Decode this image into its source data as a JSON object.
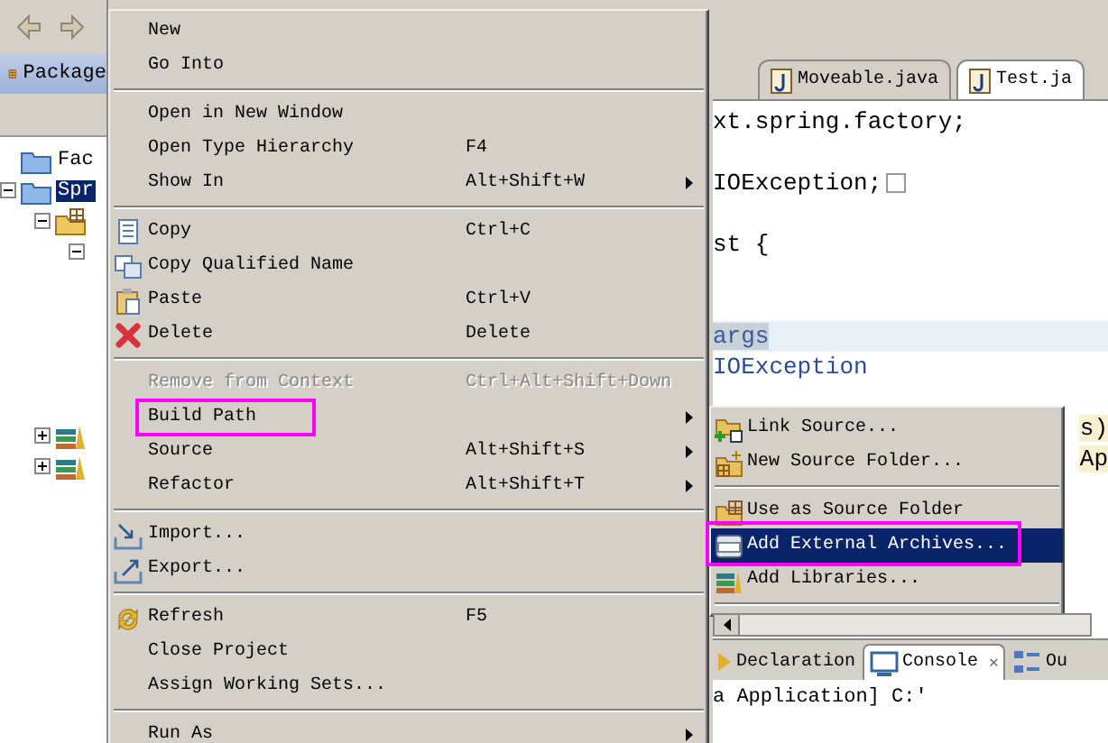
{
  "package_explorer": {
    "tab": "Package",
    "tree": [
      {
        "label": "Fac",
        "kind": "project",
        "selected": false
      },
      {
        "label": "Spr",
        "kind": "project",
        "selected": true,
        "expanded": true,
        "children": [
          {
            "kind": "folder",
            "expanded": true,
            "children": [
              {
                "expanded": true
              }
            ]
          },
          {
            "kind": "library",
            "expanded": false
          },
          {
            "kind": "library",
            "expanded": false
          }
        ]
      }
    ]
  },
  "editor": {
    "tabs": [
      {
        "label": "Moveable.java",
        "selected": false
      },
      {
        "label": "Test.ja",
        "selected": true
      }
    ],
    "lines": [
      {
        "text": "xt.spring.factory;",
        "kind": "plain"
      },
      {
        "kind": "blank"
      },
      {
        "text": "IOException;",
        "kind": "folded"
      },
      {
        "kind": "blank"
      },
      {
        "text": "st {",
        "kind": "plain"
      },
      {
        "kind": "blank"
      },
      {
        "kind": "blank"
      },
      {
        "text": "args",
        "kind": "current"
      },
      {
        "text": "IOException",
        "kind": "keyword"
      },
      {
        "kind": "blank"
      },
      {
        "text": "s)",
        "kind": "tail"
      },
      {
        "text": "Ap",
        "kind": "tail"
      }
    ]
  },
  "bottom_panel": {
    "tabs": [
      {
        "label": "Declaration",
        "selected": false,
        "kind": "declaration"
      },
      {
        "label": "Console",
        "selected": true,
        "kind": "console",
        "close": "✕"
      },
      {
        "label": "Ou",
        "selected": false,
        "kind": "outline"
      }
    ],
    "console_line": "a Application] C:'"
  },
  "context_menu": {
    "items": [
      {
        "kind": "item",
        "label": "New",
        "disabled": false,
        "submenu": false,
        "annotated": false
      },
      {
        "kind": "item",
        "label": "Go Into",
        "disabled": false,
        "submenu": false,
        "annotated": false
      },
      {
        "kind": "separator"
      },
      {
        "kind": "item",
        "label": "Open in New Window",
        "disabled": false,
        "submenu": false,
        "annotated": false
      },
      {
        "kind": "item",
        "label": "Open Type Hierarchy",
        "shortcut": "F4",
        "disabled": false,
        "submenu": false,
        "annotated": false
      },
      {
        "kind": "item",
        "label": "Show In",
        "shortcut": "Alt+Shift+W",
        "disabled": false,
        "submenu": true,
        "annotated": false
      },
      {
        "kind": "separator"
      },
      {
        "kind": "copy",
        "label": "Copy",
        "shortcut": "Ctrl+C",
        "disabled": false,
        "submenu": false,
        "annotated": false
      },
      {
        "kind": "copyname",
        "label": "Copy Qualified Name",
        "disabled": false,
        "submenu": false,
        "annotated": false
      },
      {
        "kind": "paste",
        "label": "Paste",
        "shortcut": "Ctrl+V",
        "disabled": false,
        "submenu": false,
        "annotated": false
      },
      {
        "kind": "delete",
        "label": "Delete",
        "shortcut": "Delete",
        "disabled": false,
        "submenu": false,
        "annotated": false
      },
      {
        "kind": "separator"
      },
      {
        "kind": "item",
        "label": "Remove from Context",
        "shortcut": "Ctrl+Alt+Shift+Down",
        "disabled": true,
        "submenu": false,
        "annotated": false
      },
      {
        "kind": "item",
        "label": "Build Path",
        "disabled": false,
        "submenu": true,
        "annotated": true
      },
      {
        "kind": "item",
        "label": "Source",
        "shortcut": "Alt+Shift+S",
        "disabled": false,
        "submenu": true,
        "annotated": false
      },
      {
        "kind": "item",
        "label": "Refactor",
        "shortcut": "Alt+Shift+T",
        "disabled": false,
        "submenu": true,
        "annotated": false
      },
      {
        "kind": "separator"
      },
      {
        "kind": "import",
        "label": "Import...",
        "disabled": false,
        "submenu": false,
        "annotated": false
      },
      {
        "kind": "export",
        "label": "Export...",
        "disabled": false,
        "submenu": false,
        "annotated": false
      },
      {
        "kind": "separator"
      },
      {
        "kind": "refresh",
        "label": "Refresh",
        "shortcut": "F5",
        "disabled": false,
        "submenu": false,
        "annotated": false
      },
      {
        "kind": "item",
        "label": "Close Project",
        "disabled": false,
        "submenu": false,
        "annotated": false
      },
      {
        "kind": "item",
        "label": "Assign Working Sets...",
        "disabled": false,
        "submenu": false,
        "annotated": false
      },
      {
        "kind": "separator"
      },
      {
        "kind": "item",
        "label": "Run As",
        "disabled": false,
        "submenu": true,
        "annotated": false
      }
    ]
  },
  "build_path_submenu": {
    "items": [
      {
        "kind": "linksource",
        "label": "Link Source...",
        "selected": false,
        "annotated": false
      },
      {
        "kind": "newfolder",
        "label": "New Source Folder...",
        "selected": false,
        "annotated": false
      },
      {
        "kind": "separator"
      },
      {
        "kind": "sourcefolder",
        "label": "Use as Source Folder",
        "selected": false,
        "annotated": false
      },
      {
        "kind": "archive",
        "label": "Add External Archives...",
        "selected": true,
        "annotated": true
      },
      {
        "kind": "library",
        "label": "Add Libraries...",
        "selected": false,
        "annotated": false
      },
      {
        "kind": "separator"
      }
    ]
  }
}
